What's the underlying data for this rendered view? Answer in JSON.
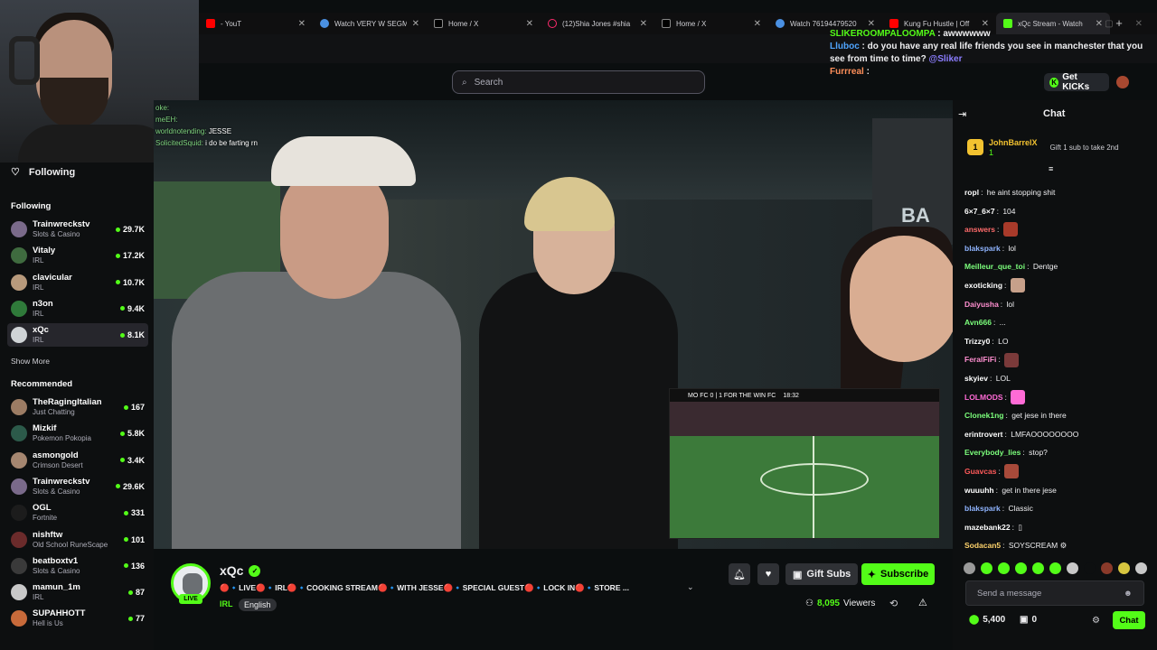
{
  "browser": {
    "tabs": [
      {
        "label": "- YouT",
        "favicon": "youtube-favicon",
        "active": false
      },
      {
        "label": "Watch VERY W SEGM",
        "favicon": "globe-favicon",
        "active": false
      },
      {
        "label": "Home / X",
        "favicon": "x-favicon",
        "active": false
      },
      {
        "label": "(12)Shia Jones #shia",
        "favicon": "tiktok-favicon",
        "active": false
      },
      {
        "label": "Home / X",
        "favicon": "x-favicon",
        "active": false
      },
      {
        "label": "Watch 76194479520",
        "favicon": "globe-favicon",
        "active": false
      },
      {
        "label": "Kung Fu Hustle | Off",
        "favicon": "youtube-favicon",
        "active": false
      },
      {
        "label": "xQc Stream - Watch",
        "favicon": "kick-favicon",
        "active": true
      }
    ],
    "new_tab": "+"
  },
  "overlay_chat": [
    {
      "user": "SLIKEROOMPALOOMPA",
      "text": "awwwwww",
      "color": "#53fc18"
    },
    {
      "user": "Lluboc",
      "text": "do you have any real life friends you see in manchester that you see from time to time?",
      "mention": "@Sliker",
      "color": "#4fa5ff"
    },
    {
      "user": "Furrreal",
      "text": "",
      "color": "#ff8f5a"
    }
  ],
  "header": {
    "search_placeholder": "Search",
    "get_kicks": "Get KICKs"
  },
  "sidebar": {
    "title": "Following",
    "following_label": "Following",
    "following": [
      {
        "name": "Trainwreckstv",
        "category": "Slots & Casino",
        "viewers": "29.7K",
        "color": "#7a6a8a",
        "selected": false
      },
      {
        "name": "Vitaly",
        "category": "IRL",
        "viewers": "17.2K",
        "color": "#3f6b3f",
        "selected": false
      },
      {
        "name": "clavicular",
        "category": "IRL",
        "viewers": "10.7K",
        "color": "#b89a7c",
        "selected": false
      },
      {
        "name": "n3on",
        "category": "IRL",
        "viewers": "9.4K",
        "color": "#2f7a3a",
        "selected": false
      },
      {
        "name": "xQc",
        "category": "IRL",
        "viewers": "8.1K",
        "color": "#cfd3d6",
        "selected": true
      }
    ],
    "show_more": "Show More",
    "recommended_label": "Recommended",
    "recommended": [
      {
        "name": "TheRagingItalian",
        "category": "Just Chatting",
        "viewers": "167",
        "color": "#9c7c64"
      },
      {
        "name": "Mizkif",
        "category": "Pokemon Pokopia",
        "viewers": "5.8K",
        "color": "#2c5a4a"
      },
      {
        "name": "asmongold",
        "category": "Crimson Desert",
        "viewers": "3.4K",
        "color": "#a58670"
      },
      {
        "name": "Trainwreckstv",
        "category": "Slots & Casino",
        "viewers": "29.6K",
        "color": "#7a6a8a"
      },
      {
        "name": "OGL",
        "category": "Fortnite",
        "viewers": "331",
        "color": "#1c1c1c"
      },
      {
        "name": "nishftw",
        "category": "Old School RuneScape",
        "viewers": "101",
        "color": "#6b2b2b"
      },
      {
        "name": "beatboxtv1",
        "category": "Slots & Casino",
        "viewers": "136",
        "color": "#3a3a3a"
      },
      {
        "name": "mamun_1m",
        "category": "IRL",
        "viewers": "87",
        "color": "#c8c8c8"
      },
      {
        "name": "SUPAHHOTT",
        "category": "Hell is Us",
        "viewers": "77",
        "color": "#c86a3a"
      }
    ]
  },
  "video": {
    "overlay_chat": [
      {
        "user": "",
        "text": ""
      },
      {
        "user": "",
        "text": ""
      },
      {
        "user": "oke:",
        "text": ""
      },
      {
        "user": "meEH:",
        "text": ""
      },
      {
        "user": "worldnotending:",
        "text": "JESSE"
      },
      {
        "user": "SolicitedSquid:",
        "text": "i do be farting rn"
      }
    ],
    "sign_text": "BA",
    "pip_score": "MO FC  0 | 1  FOR THE WIN FC",
    "pip_clock": "18:32"
  },
  "stream": {
    "channel": "xQc",
    "live": "LIVE",
    "title": "🔴🔹LIVE🔴🔹IRL🔴🔹COOKING STREAM🔴🔹WITH JESSE🔴🔹SPECIAL GUEST🔴🔹LOCK IN🔴🔹STORE ...",
    "category": "IRL",
    "language": "English",
    "viewers": "8,095",
    "viewers_label": "Viewers",
    "gift_subs": "Gift Subs",
    "subscribe": "Subscribe"
  },
  "chat": {
    "title": "Chat",
    "pinned": {
      "rank": "1",
      "user": "JohnBarrelX",
      "subs": "1",
      "gift_text": "Gift 1 sub to take 2nd"
    },
    "messages": [
      {
        "user": "ropl",
        "text": "he aint stopping shit",
        "color": "#ffffff",
        "emote": ""
      },
      {
        "user": "6×7_6×7",
        "text": "104",
        "color": "#ffffff",
        "emote": ""
      },
      {
        "user": "answers",
        "text": "",
        "color": "#ff6b6b",
        "emote": "#a83a2a"
      },
      {
        "user": "blakspark",
        "text": "lol",
        "color": "#8fb4ff",
        "emote": ""
      },
      {
        "user": "Meilleur_que_toi",
        "text": "Dentge",
        "color": "#7cff7c",
        "emote": ""
      },
      {
        "user": "exoticking",
        "text": "",
        "color": "#ffffff",
        "emote": "#c7a08a"
      },
      {
        "user": "Daiyusha",
        "text": "lol",
        "color": "#ff8fd0",
        "emote": ""
      },
      {
        "user": "Avn666",
        "text": "...",
        "color": "#7cff7c",
        "emote": ""
      },
      {
        "user": "Trizzy0",
        "text": "LO",
        "color": "#ffffff",
        "emote": ""
      },
      {
        "user": "FeralFiFi",
        "text": "",
        "color": "#ff8fd0",
        "emote": "#7a3a3a"
      },
      {
        "user": "skyiev",
        "text": "LOL",
        "color": "#ffffff",
        "emote": ""
      },
      {
        "user": "LOLMODS",
        "text": "",
        "color": "#ff6bd6",
        "emote": "#ff6bd6"
      },
      {
        "user": "Clonek1ng",
        "text": "get jese in there",
        "color": "#7cff7c",
        "emote": ""
      },
      {
        "user": "erintrovert",
        "text": "LMFAOOOOOOOO",
        "color": "#ffffff",
        "emote": ""
      },
      {
        "user": "Everybody_lies",
        "text": "stop?",
        "color": "#7cff7c",
        "emote": ""
      },
      {
        "user": "Guavcas",
        "text": "",
        "color": "#ff5a5a",
        "emote": "#a84a3a"
      },
      {
        "user": "wuuuhh",
        "text": "get in there jese",
        "color": "#ffffff",
        "emote": ""
      },
      {
        "user": "blakspark",
        "text": "Classic",
        "color": "#8fb4ff",
        "emote": ""
      },
      {
        "user": "mazebank22",
        "text": "▯",
        "color": "#ffffff",
        "emote": ""
      },
      {
        "user": "Sodacan5",
        "text": "SOYSCREAM ⚙",
        "color": "#ffd36b",
        "emote": ""
      }
    ],
    "input_placeholder": "Send a message",
    "kicks_balance": "5,400",
    "gift_balance": "0",
    "chat_button": "Chat"
  }
}
